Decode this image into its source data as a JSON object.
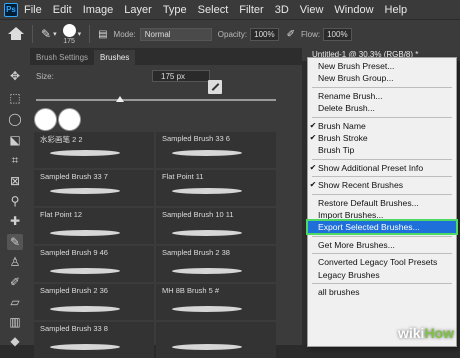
{
  "menubar": {
    "logo": "Ps",
    "items": [
      "File",
      "Edit",
      "Image",
      "Layer",
      "Type",
      "Select",
      "Filter",
      "3D",
      "View",
      "Window",
      "Help"
    ]
  },
  "options": {
    "brush_size": "175",
    "mode_label": "Mode:",
    "mode_value": "Normal",
    "opacity_label": "Opacity:",
    "opacity_value": "100%",
    "flow_label": "Flow:",
    "flow_value": "100%"
  },
  "panel": {
    "tabs": [
      "Brush Settings",
      "Brushes"
    ],
    "active_tab": 1,
    "size_label": "Size:",
    "size_value": "175 px",
    "size_fraction": 0.35,
    "brushes": [
      [
        "水彩画笔 2 2",
        "Sampled Brush 33 6"
      ],
      [
        "Sampled Brush 33 7",
        "Flat Point 11"
      ],
      [
        "Flat Point 12",
        "Sampled Brush 10 11"
      ],
      [
        "Sampled Brush 9 46",
        "Sampled Brush 2 38"
      ],
      [
        "Sampled Brush 2 36",
        "MH 8B Brush 5 #"
      ],
      [
        "Sampled Brush 33 8",
        ""
      ]
    ]
  },
  "document": {
    "tab_title": "Untitled-1 @ 30.3% (RGB/8) *"
  },
  "context_menu": {
    "items": [
      {
        "label": "New Brush Preset..."
      },
      {
        "label": "New Brush Group..."
      },
      {
        "sep": true
      },
      {
        "label": "Rename Brush..."
      },
      {
        "label": "Delete Brush..."
      },
      {
        "sep": true
      },
      {
        "label": "Brush Name",
        "checked": true
      },
      {
        "label": "Brush Stroke",
        "checked": true
      },
      {
        "label": "Brush Tip",
        "checked": false
      },
      {
        "sep": true
      },
      {
        "label": "Show Additional Preset Info",
        "checked": true
      },
      {
        "sep": true
      },
      {
        "label": "Show Recent Brushes",
        "checked": true
      },
      {
        "sep": true
      },
      {
        "label": "Restore Default Brushes..."
      },
      {
        "label": "Import Brushes..."
      },
      {
        "label": "Export Selected Brushes...",
        "highlighted": true
      },
      {
        "sep": true
      },
      {
        "label": "Get More Brushes..."
      },
      {
        "sep": true
      },
      {
        "label": "Converted Legacy Tool Presets"
      },
      {
        "label": "Legacy Brushes"
      },
      {
        "sep": true
      },
      {
        "label": "all brushes"
      }
    ]
  },
  "watermark": {
    "part1": "wiki",
    "part2": "How"
  }
}
